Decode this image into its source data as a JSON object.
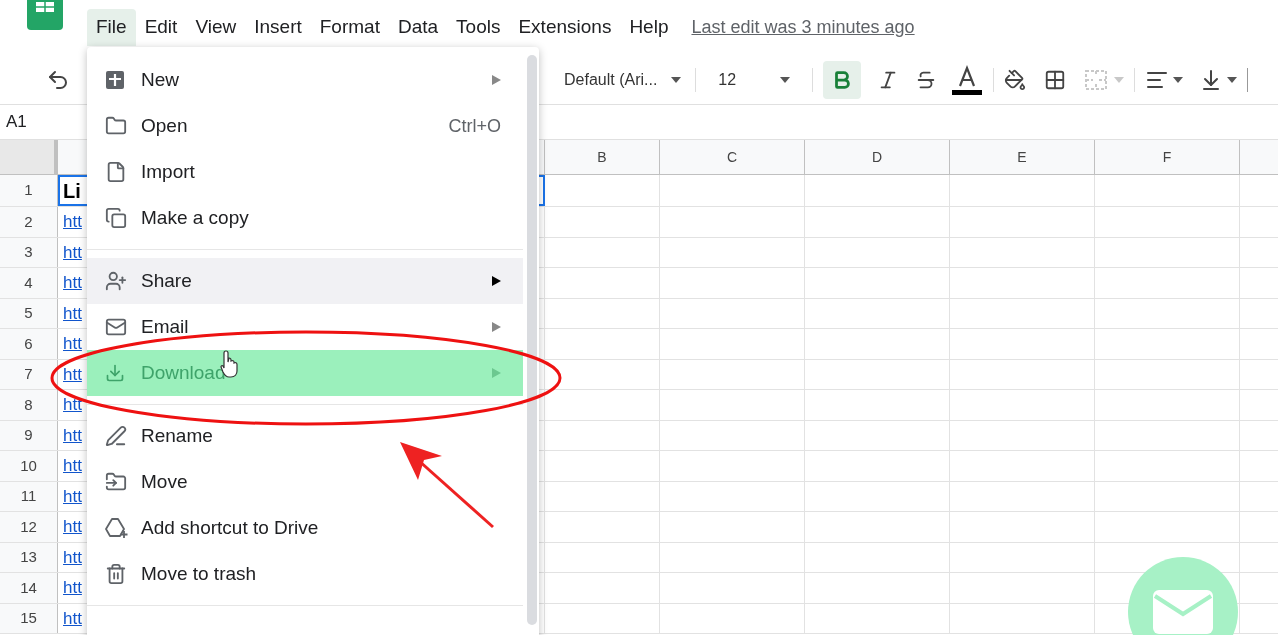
{
  "menu_bar": [
    {
      "label": "File",
      "selected": true
    },
    {
      "label": "Edit",
      "selected": false
    },
    {
      "label": "View",
      "selected": false
    },
    {
      "label": "Insert",
      "selected": false
    },
    {
      "label": "Format",
      "selected": false
    },
    {
      "label": "Data",
      "selected": false
    },
    {
      "label": "Tools",
      "selected": false
    },
    {
      "label": "Extensions",
      "selected": false
    },
    {
      "label": "Help",
      "selected": false
    }
  ],
  "last_edit": "Last edit was 3 minutes ago",
  "toolbar": {
    "font": "Default (Ari...",
    "font_size": "12",
    "bold": true,
    "merge_disabled": true
  },
  "name_box": "A1",
  "columns": [
    "B",
    "C",
    "D",
    "E",
    "F"
  ],
  "rows": [
    {
      "number": "1",
      "cell": "Li",
      "kind": "header"
    },
    {
      "number": "2",
      "cell": "htt",
      "kind": "link"
    },
    {
      "number": "3",
      "cell": "htt",
      "kind": "link"
    },
    {
      "number": "4",
      "cell": "htt",
      "kind": "link"
    },
    {
      "number": "5",
      "cell": "htt",
      "kind": "link"
    },
    {
      "number": "6",
      "cell": "htt",
      "kind": "link"
    },
    {
      "number": "7",
      "cell": "htt",
      "kind": "link"
    },
    {
      "number": "8",
      "cell": "htt",
      "kind": "link"
    },
    {
      "number": "9",
      "cell": "htt",
      "kind": "link"
    },
    {
      "number": "10",
      "cell": "htt",
      "kind": "link"
    },
    {
      "number": "11",
      "cell": "htt",
      "kind": "link"
    },
    {
      "number": "12",
      "cell": "htt",
      "kind": "link"
    },
    {
      "number": "13",
      "cell": "htt",
      "kind": "link"
    },
    {
      "number": "14",
      "cell": "htt",
      "kind": "link"
    },
    {
      "number": "15",
      "cell": "htt",
      "kind": "link"
    }
  ],
  "file_menu": [
    [
      {
        "label": "New",
        "submenu": true,
        "hovered": false,
        "highlighted": false
      },
      {
        "label": "Open",
        "shortcut": "Ctrl+O",
        "submenu": false,
        "hovered": false,
        "highlighted": false
      },
      {
        "label": "Import",
        "submenu": false,
        "hovered": false,
        "highlighted": false
      },
      {
        "label": "Make a copy",
        "submenu": false,
        "hovered": false,
        "highlighted": false
      }
    ],
    [
      {
        "label": "Share",
        "submenu": true,
        "hovered": true,
        "highlighted": false
      },
      {
        "label": "Email",
        "submenu": true,
        "hovered": false,
        "highlighted": false
      },
      {
        "label": "Download",
        "submenu": true,
        "hovered": false,
        "highlighted": true
      }
    ],
    [
      {
        "label": "Rename",
        "submenu": false,
        "hovered": false,
        "highlighted": false
      },
      {
        "label": "Move",
        "submenu": false,
        "hovered": false,
        "highlighted": false
      },
      {
        "label": "Add shortcut to Drive",
        "submenu": false,
        "hovered": false,
        "highlighted": false
      },
      {
        "label": "Move to trash",
        "submenu": false,
        "hovered": false,
        "highlighted": false
      }
    ]
  ]
}
